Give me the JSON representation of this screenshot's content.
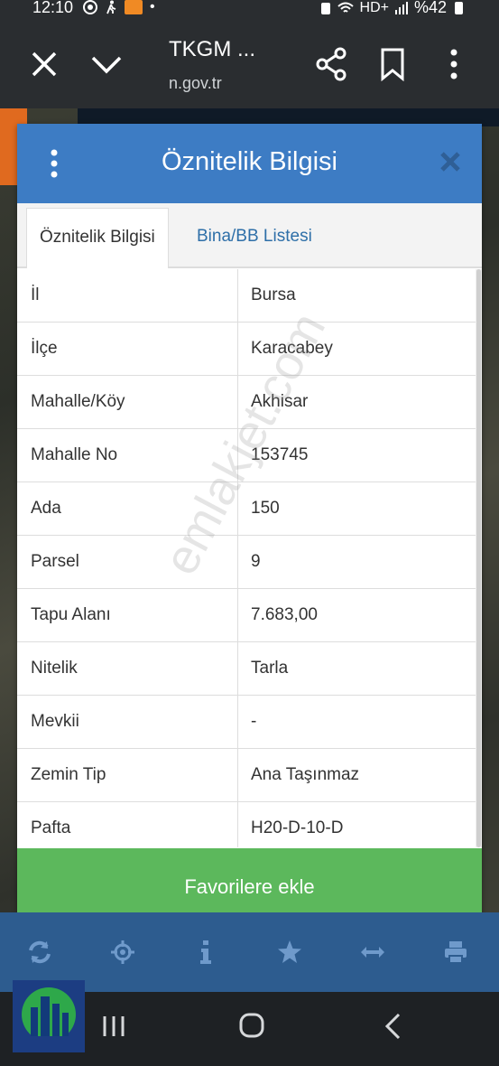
{
  "status_bar": {
    "time": "12:10",
    "network": "HD+",
    "battery": "%42"
  },
  "browser": {
    "title": "TKGM ...",
    "url": "n.gov.tr"
  },
  "dialog": {
    "title": "Öznitelik Bilgisi",
    "tabs": [
      {
        "label": "Öznitelik Bilgisi",
        "active": true
      },
      {
        "label": "Bina/BB Listesi",
        "active": false
      }
    ],
    "rows": [
      {
        "key": "İl",
        "value": "Bursa"
      },
      {
        "key": "İlçe",
        "value": "Karacabey"
      },
      {
        "key": "Mahalle/Köy",
        "value": "Akhisar"
      },
      {
        "key": "Mahalle No",
        "value": "153745"
      },
      {
        "key": "Ada",
        "value": "150"
      },
      {
        "key": "Parsel",
        "value": "9"
      },
      {
        "key": "Tapu Alanı",
        "value": "7.683,00"
      },
      {
        "key": "Nitelik",
        "value": "Tarla"
      },
      {
        "key": "Mevkii",
        "value": "-"
      },
      {
        "key": "Zemin Tip",
        "value": "Ana Taşınmaz"
      },
      {
        "key": "Pafta",
        "value": "H20-D-10-D"
      }
    ],
    "favorite_label": "Favorilere ekle"
  },
  "watermark": "emlakjet.com",
  "map_toolbar": {
    "icons": [
      "refresh-icon",
      "locate-icon",
      "info-icon",
      "star-icon",
      "measure-icon",
      "print-icon"
    ]
  },
  "colors": {
    "header": "#3d7cc4",
    "favorite": "#5cb85c",
    "toolbar": "#2d5c8f"
  }
}
